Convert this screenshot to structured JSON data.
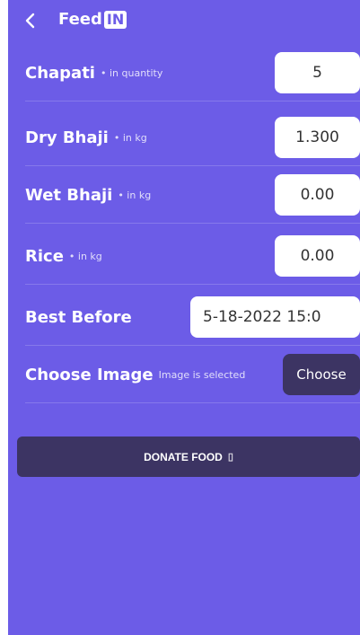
{
  "appbar": {
    "back_icon": "chevron-left-icon",
    "brand_text": "Feed",
    "brand_badge": "IN"
  },
  "form": {
    "rows": [
      {
        "label": "Chapati",
        "hint": "• in quantity",
        "value": "5"
      },
      {
        "label": "Dry Bhaji",
        "hint": "• in kg",
        "value": "1.300"
      },
      {
        "label": "Wet Bhaji",
        "hint": "• in kg",
        "value": "0.00"
      },
      {
        "label": "Rice",
        "hint": "• in kg",
        "value": "0.00"
      }
    ],
    "best_before": {
      "label": "Best Before",
      "value": "5-18-2022 15:0"
    },
    "image": {
      "label": "Choose Image",
      "status": "Image is selected",
      "button": "Choose"
    }
  },
  "donate": {
    "label": "DONATE FOOD",
    "glyph": "▯"
  },
  "colors": {
    "background": "#6c5ce7",
    "dark_button": "#3c3463",
    "input": "#ffffff"
  }
}
